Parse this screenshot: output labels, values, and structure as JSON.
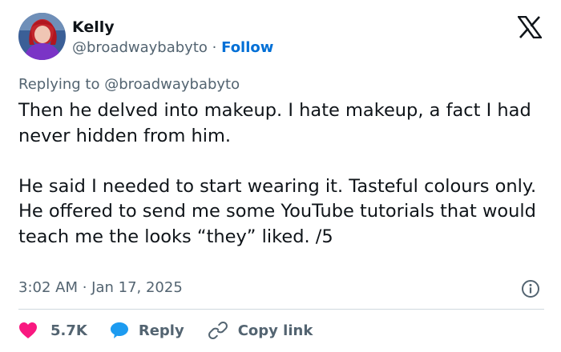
{
  "author": {
    "name": "Kelly",
    "handle": "@broadwaybabyto",
    "separator": "·",
    "follow_label": "Follow"
  },
  "reply_context": {
    "prefix": "Replying to",
    "mention": "@broadwaybabyto"
  },
  "tweet": {
    "paragraph_1": "Then he delved into makeup. I hate makeup, a fact I had never hidden from him.",
    "paragraph_2": "He said I needed to start wearing it. Tasteful colours only. He offered to send me some YouTube tutorials that would teach me the looks “they” liked. /5",
    "timestamp": "3:02 AM · Jan 17, 2025"
  },
  "actions": {
    "likes_count": "5.7K",
    "reply_label": "Reply",
    "copy_label": "Copy link"
  },
  "colors": {
    "like_icon": "#f91880",
    "reply_icon": "#1d9bf0",
    "follow_link": "#006fd6",
    "secondary_text": "#536471",
    "divider": "#cfd9de"
  },
  "icons": {
    "logo": "x-logo-icon",
    "info": "info-icon",
    "like": "heart-icon",
    "reply": "speech-bubble-icon",
    "copy": "link-icon"
  }
}
